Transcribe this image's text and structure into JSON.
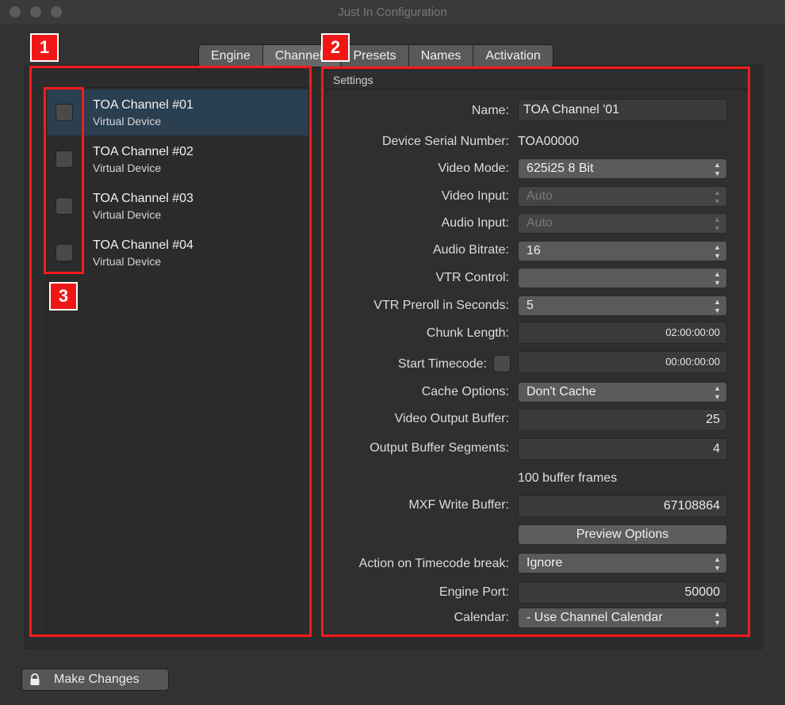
{
  "window": {
    "title": "Just In Configuration"
  },
  "tabs": [
    "Engine",
    "Channels",
    "Presets",
    "Names",
    "Activation"
  ],
  "channels": [
    {
      "title": "TOA Channel #01",
      "subtitle": "Virtual Device"
    },
    {
      "title": "TOA Channel #02",
      "subtitle": "Virtual Device"
    },
    {
      "title": "TOA Channel #03",
      "subtitle": "Virtual Device"
    },
    {
      "title": "TOA Channel #04",
      "subtitle": "Virtual Device"
    }
  ],
  "settings": {
    "header": "Settings",
    "name_label": "Name:",
    "name_value": "TOA Channel '01",
    "serial_label": "Device Serial Number:",
    "serial_value": "TOA00000",
    "video_mode_label": "Video Mode:",
    "video_mode_value": "625i25 8 Bit",
    "video_input_label": "Video Input:",
    "video_input_value": "Auto",
    "audio_input_label": "Audio Input:",
    "audio_input_value": "Auto",
    "audio_bitrate_label": "Audio Bitrate:",
    "audio_bitrate_value": "16",
    "vtr_control_label": "VTR Control:",
    "vtr_control_value": "",
    "vtr_preroll_label": "VTR Preroll in Seconds:",
    "vtr_preroll_value": "5",
    "chunk_length_label": "Chunk Length:",
    "chunk_length_value": "02:00:00:00",
    "start_timecode_label": "Start Timecode:",
    "start_timecode_value": "00:00:00:00",
    "cache_options_label": "Cache Options:",
    "cache_options_value": "Don't Cache",
    "video_output_buffer_label": "Video Output Buffer:",
    "video_output_buffer_value": "25",
    "output_buffer_segments_label": "Output Buffer Segments:",
    "output_buffer_segments_value": "4",
    "buffer_frames_text": "100 buffer frames",
    "mxf_write_buffer_label": "MXF Write Buffer:",
    "mxf_write_buffer_value": "67108864",
    "preview_options_label": "Preview Options",
    "timecode_break_label": "Action on Timecode break:",
    "timecode_break_value": "Ignore",
    "engine_port_label": "Engine Port:",
    "engine_port_value": "50000",
    "calendar_label": "Calendar:",
    "calendar_value": "- Use Channel Calendar"
  },
  "annotations": [
    "1",
    "2",
    "3"
  ],
  "footer": {
    "make_changes_label": "Make Changes"
  },
  "colors": {
    "annotation_red": "#ff1a1a",
    "selection": "#2a3f50"
  },
  "icons": {
    "lock": "lock-icon",
    "stepper": "stepper-arrows-icon"
  }
}
